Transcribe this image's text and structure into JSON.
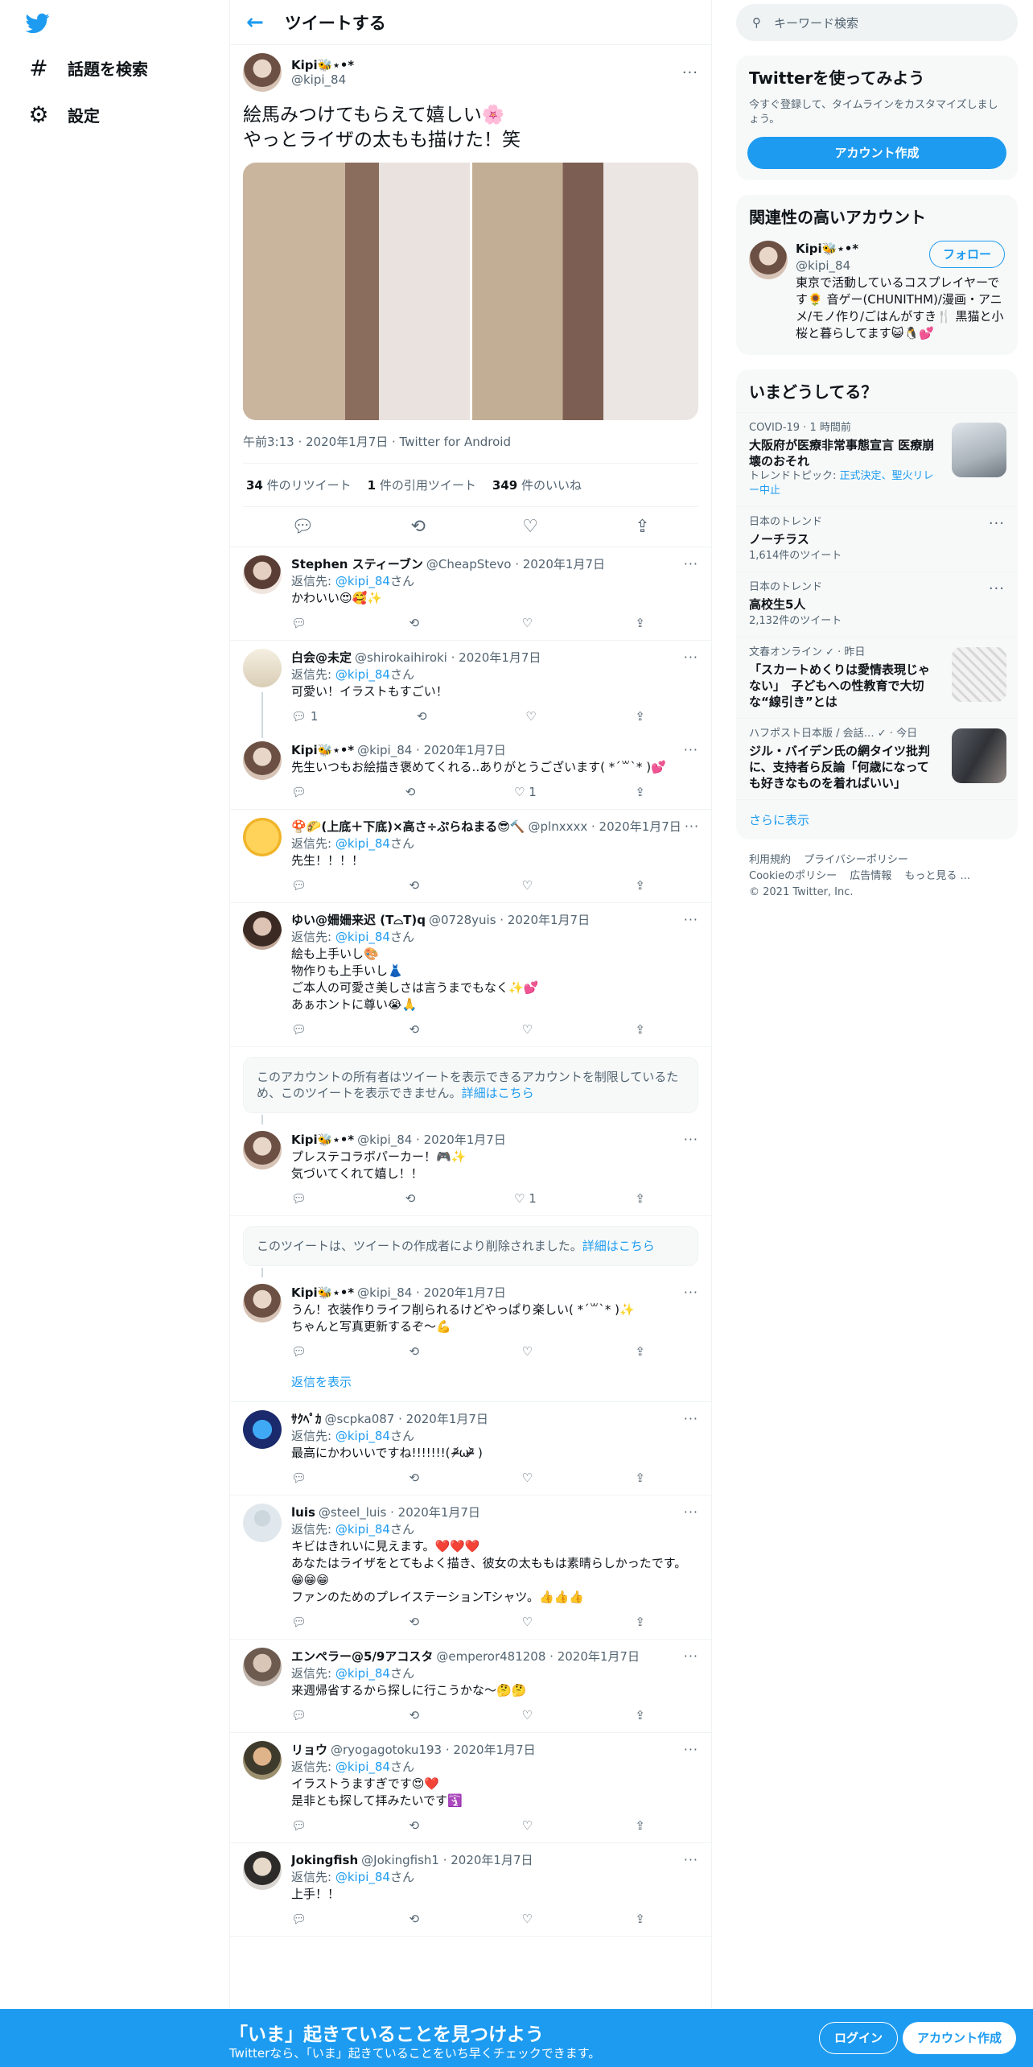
{
  "nav": {
    "explore_label": "話題を検索",
    "settings_label": "設定"
  },
  "header": {
    "title": "ツイートする"
  },
  "main_tweet": {
    "name": "Kipi🐝⋆•*",
    "handle": "@kipi_84",
    "text": "絵馬みつけてもらえて嬉しい🌸\nやっとライザの太もも描けた！笑",
    "meta": "午前3:13 · 2020年1月7日 · Twitter for Android",
    "retweets_count": "34",
    "retweets_label": "件のリツイート",
    "quotes_count": "1",
    "quotes_label": "件の引用ツイート",
    "likes_count": "349",
    "likes_label": "件のいいね"
  },
  "replies": [
    {
      "name": "Stephen スティーブン",
      "handle": "@CheapStevo · 2020年1月7日",
      "reply_prefix": "返信先: ",
      "reply_to": "@kipi_84",
      "reply_suffix": "さん",
      "text": "かわいい😍🥰✨",
      "reply_count": "",
      "like_count": ""
    },
    {
      "name": "白会@未定",
      "handle": "@shirokaihiroki · 2020年1月7日",
      "reply_prefix": "返信先: ",
      "reply_to": "@kipi_84",
      "reply_suffix": "さん",
      "text": "可愛い！イラストもすごい！",
      "reply_count": "1",
      "like_count": ""
    },
    {
      "name": "Kipi🐝⋆•*",
      "handle": "@kipi_84 · 2020年1月7日",
      "text": "先生いつもお絵描き褒めてくれる..ありがとうございます( *´꒳`* )💕",
      "reply_count": "",
      "like_count": "1"
    },
    {
      "name": "🍄🌮(上底＋下底)×高さ÷ぷらねまる😎🔨",
      "handle": "@plnxxxx · 2020年1月7日",
      "reply_prefix": "返信先: ",
      "reply_to": "@kipi_84",
      "reply_suffix": "さん",
      "text": "先生！！！！",
      "reply_count": "",
      "like_count": ""
    },
    {
      "name": "ゆい@姍姍来迟 (T⌓T)q",
      "handle": "@0728yuis · 2020年1月7日",
      "reply_prefix": "返信先: ",
      "reply_to": "@kipi_84",
      "reply_suffix": "さん",
      "text": "絵も上手いし🎨\n物作りも上手いし👗\nご本人の可愛さ美しさは言うまでもなく✨💕\nあぁホントに尊い😭🙏",
      "reply_count": "",
      "like_count": ""
    },
    {
      "name": "Kipi🐝⋆•*",
      "handle": "@kipi_84 · 2020年1月7日",
      "text": "プレステコラボパーカー！🎮✨\n気づいてくれて嬉し！！",
      "reply_count": "",
      "like_count": "1"
    },
    {
      "name": "Kipi🐝⋆•*",
      "handle": "@kipi_84 · 2020年1月7日",
      "text": "うん！衣装作りライフ削られるけどやっぱり楽しい( *´꒳`* )✨\nちゃんと写真更新するぞ〜💪",
      "reply_count": "",
      "like_count": ""
    },
    {
      "name": "ｻｸﾍﾟｶ",
      "handle": "@scpka087 · 2020年1月7日",
      "reply_prefix": "返信先: ",
      "reply_to": "@kipi_84",
      "reply_suffix": "さん",
      "text": "最高にかわいいですね!!!!!!!( ᵒ̴̶̷᷄ωᵒ̴̶̷᷅ )",
      "reply_count": "",
      "like_count": ""
    },
    {
      "name": "luis",
      "handle": "@steel_luis · 2020年1月7日",
      "reply_prefix": "返信先: ",
      "reply_to": "@kipi_84",
      "reply_suffix": "さん",
      "text": "キビはきれいに見えます。❤️❤️❤️\nあなたはライザをとてもよく描き、彼女の太ももは素晴らしかったです。😁😁😁\nファンのためのプレイステーションTシャツ。👍👍👍",
      "reply_count": "",
      "like_count": ""
    },
    {
      "name": "エンペラー@5/9アコスタ",
      "handle": "@emperor481208 · 2020年1月7日",
      "reply_prefix": "返信先: ",
      "reply_to": "@kipi_84",
      "reply_suffix": "さん",
      "text": "来週帰省するから探しに行こうかな～🤔🤔",
      "reply_count": "",
      "like_count": ""
    },
    {
      "name": "リョウ",
      "handle": "@ryogagotoku193 · 2020年1月7日",
      "reply_prefix": "返信先: ",
      "reply_to": "@kipi_84",
      "reply_suffix": "さん",
      "text": "イラストうますぎです😍❤️\n是非とも探して拝みたいです🛐",
      "reply_count": "",
      "like_count": ""
    },
    {
      "name": "Jokingfish",
      "handle": "@Jokingfish1 · 2020年1月7日",
      "reply_prefix": "返信先: ",
      "reply_to": "@kipi_84",
      "reply_suffix": "さん",
      "text": "上手！！",
      "reply_count": "",
      "like_count": ""
    }
  ],
  "notice_restricted": {
    "text": "このアカウントの所有者はツイートを表示できるアカウントを制限しているため、このツイートを表示できません。",
    "link": "詳細はこちら"
  },
  "notice_deleted": {
    "text": "このツイートは、ツイートの作成者により削除されました。",
    "link": "詳細はこちら"
  },
  "show_replies_label": "返信を表示",
  "right": {
    "search_placeholder": "キーワード検索",
    "signup_card": {
      "title": "Twitterを使ってみよう",
      "sub": "今すぐ登録して、タイムラインをカスタマイズしましょう。",
      "button": "アカウント作成"
    },
    "related": {
      "title": "関連性の高いアカウント",
      "name": "Kipi🐝⋆•*",
      "handle": "@kipi_84",
      "follow": "フォロー",
      "bio": "東京で活動しているコスプレイヤーです🌻 音ゲー(CHUNITHM)/漫画・アニメ/モノ作り/ごはんがすき🍴 黒猫と小桜と暮らしてます😺🐧💕"
    },
    "trends": {
      "title": "いまどうしてる？",
      "items": [
        {
          "cat": "COVID-19 · 1 時間前",
          "title": "大阪府が医療非常事態宣言 医療崩壊のおそれ",
          "extra_prefix": "トレンドトピック: ",
          "extra_links": "正式決定、聖火リレー中止"
        },
        {
          "cat": "日本のトレンド",
          "title": "ノーチラス",
          "count": "1,614件のツイート"
        },
        {
          "cat": "日本のトレンド",
          "title": "高校生5人",
          "count": "2,132件のツイート"
        },
        {
          "cat": "文春オンライン ✓ · 昨日",
          "title": "「スカートめくりは愛情表現じゃない」　子どもへの性教育で大切な“線引き”とは"
        },
        {
          "cat": "ハフポスト日本版 / 会話… ✓ · 今日",
          "title": "ジル・バイデン氏の網タイツ批判に、支持者ら反論「何歳になっても好きなものを着ればいい」"
        }
      ],
      "show_more": "さらに表示"
    },
    "footer": {
      "links1": [
        "利用規約",
        "プライバシーポリシー"
      ],
      "links2": [
        "Cookieのポリシー",
        "広告情報",
        "もっと見る ..."
      ],
      "copyright": "© 2021 Twitter, Inc."
    }
  },
  "bottom_bar": {
    "title": "「いま」起きていることを見つけよう",
    "sub": "Twitterなら、「いま」起きていることをいち早くチェックできます。",
    "login": "ログイン",
    "signup": "アカウント作成"
  },
  "colors": {
    "accent": "#1d9bf0",
    "text": "#0f1419",
    "muted": "#536471"
  }
}
